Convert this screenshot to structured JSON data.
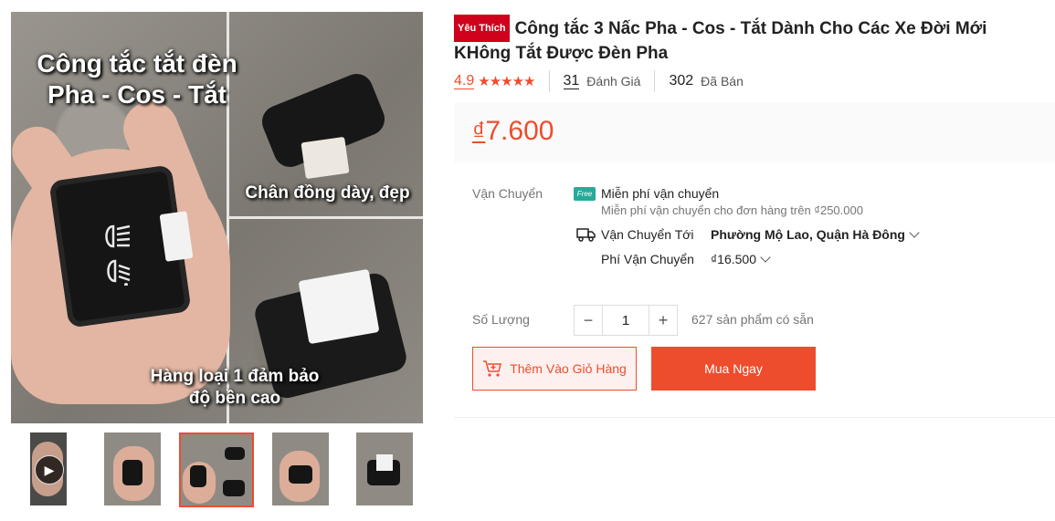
{
  "gallery": {
    "overlay_title_line1": "Công tắc tắt đèn",
    "overlay_title_line2": "Pha - Cos - Tắt",
    "overlay_caption_right": "Chân đồng dày, đẹp",
    "overlay_caption_bottom_line1": "Hàng loại 1 đảm bảo",
    "overlay_caption_bottom_line2": "độ bền cao",
    "thumbnail_count": 5,
    "active_thumbnail_index": 2,
    "video_thumbnail_icon": "play-icon"
  },
  "product": {
    "badge": "Yêu Thích",
    "title": "Công tắc 3 Nấc Pha - Cos - Tắt Dành Cho Các Xe Đời Mới KHông Tắt Được Đèn Pha",
    "rating": "4.9",
    "stars": "★★★★★",
    "review_count": "31",
    "review_label": "Đánh Giá",
    "sold_count": "302",
    "sold_label": "Đã Bán",
    "price_currency": "₫",
    "price_value": "7.600"
  },
  "shipping": {
    "label": "Vận Chuyển",
    "free_icon_text": "Free",
    "free_title": "Miễn phí vận chuyển",
    "free_desc": "Miễn phí vận chuyển cho đơn hàng trên ₫250.000",
    "to_label": "Vận Chuyển Tới",
    "to_value": "Phường Mộ Lao, Quận Hà Đông",
    "fee_label": "Phí Vận Chuyển",
    "fee_value": "₫16.500"
  },
  "quantity": {
    "label": "Số Lượng",
    "minus": "−",
    "value": "1",
    "plus": "+",
    "stock_text": "627 sản phẩm có sẵn"
  },
  "actions": {
    "add_to_cart": "Thêm Vào Giỏ Hàng",
    "buy_now": "Mua Ngay"
  },
  "colors": {
    "accent": "#ee4d2d",
    "badge": "#d0011b",
    "free_ship": "#26aa99"
  }
}
